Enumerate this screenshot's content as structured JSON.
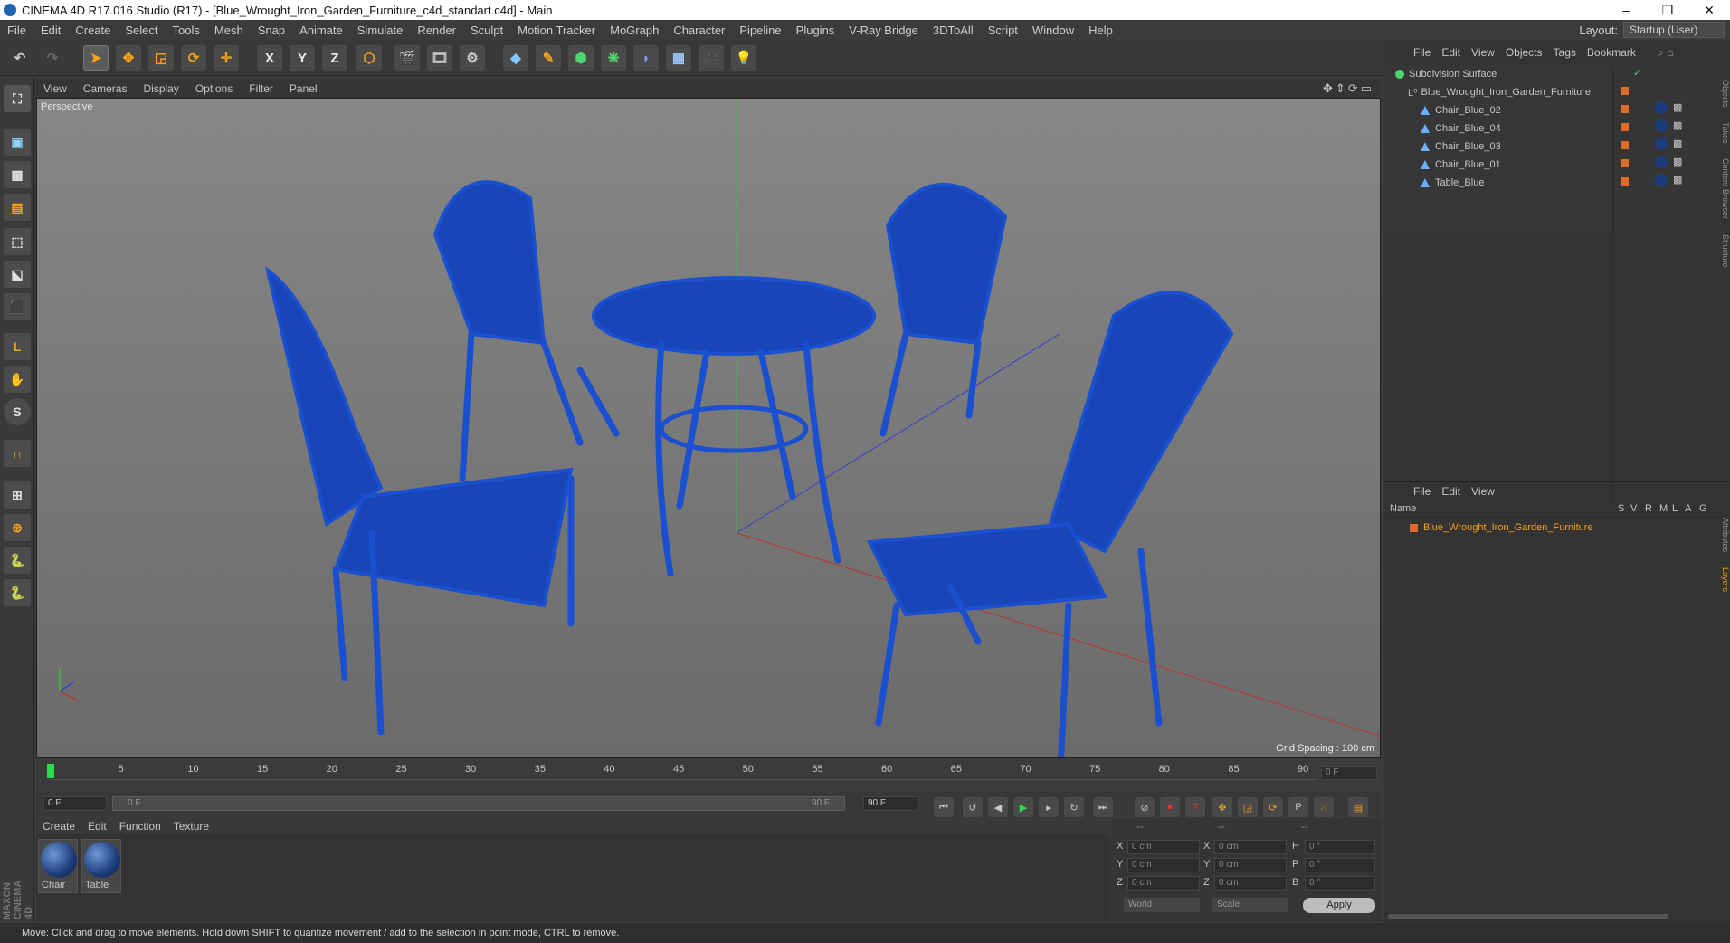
{
  "window": {
    "title": "CINEMA 4D R17.016 Studio (R17) - [Blue_Wrought_Iron_Garden_Furniture_c4d_standart.c4d] - Main",
    "minimize": "–",
    "maximize": "❐",
    "close": "✕"
  },
  "menubar": {
    "items": [
      "File",
      "Edit",
      "Create",
      "Select",
      "Tools",
      "Mesh",
      "Snap",
      "Animate",
      "Simulate",
      "Render",
      "Sculpt",
      "Motion Tracker",
      "MoGraph",
      "Character",
      "Pipeline",
      "Plugins",
      "V-Ray Bridge",
      "3DToAll",
      "Script",
      "Window",
      "Help"
    ],
    "layout_label": "Layout:",
    "layout_value": "Startup (User)"
  },
  "toolbar": {
    "x_label": "X",
    "y_label": "Y",
    "z_label": "Z"
  },
  "viewport": {
    "menu": [
      "View",
      "Cameras",
      "Display",
      "Options",
      "Filter",
      "Panel"
    ],
    "label": "Perspective",
    "grid_spacing": "Grid Spacing : 100 cm",
    "accent_color": "#1a4fd0"
  },
  "timeline": {
    "ticks": [
      "0",
      "5",
      "10",
      "15",
      "20",
      "25",
      "30",
      "35",
      "40",
      "45",
      "50",
      "55",
      "60",
      "65",
      "70",
      "75",
      "80",
      "85",
      "90"
    ],
    "current_frame_field": "0 F",
    "start_field": "0 F",
    "range_start": "0 F",
    "range_end": "90 F",
    "end_field": "90 F"
  },
  "materials": {
    "menu": [
      "Create",
      "Edit",
      "Function",
      "Texture"
    ],
    "items": [
      {
        "label": "Chair"
      },
      {
        "label": "Table"
      }
    ]
  },
  "coordinates": {
    "header": [
      "--",
      "--",
      "--"
    ],
    "rows": [
      {
        "a": "X",
        "av": "0 cm",
        "b": "X",
        "bv": "0 cm",
        "c": "H",
        "cv": "0 °"
      },
      {
        "a": "Y",
        "av": "0 cm",
        "b": "Y",
        "bv": "0 cm",
        "c": "P",
        "cv": "0 °"
      },
      {
        "a": "Z",
        "av": "0 cm",
        "b": "Z",
        "bv": "0 cm",
        "c": "B",
        "cv": "0 °"
      }
    ],
    "space": "World",
    "mode": "Scale",
    "apply": "Apply"
  },
  "object_manager": {
    "menu": [
      "File",
      "Edit",
      "View",
      "Objects",
      "Tags",
      "Bookmark"
    ],
    "objects": [
      {
        "name": "Subdivision Surface",
        "indent": 0
      },
      {
        "name": "Blue_Wrought_Iron_Garden_Furniture",
        "indent": 1
      },
      {
        "name": "Chair_Blue_02",
        "indent": 2
      },
      {
        "name": "Chair_Blue_04",
        "indent": 2
      },
      {
        "name": "Chair_Blue_03",
        "indent": 2
      },
      {
        "name": "Chair_Blue_01",
        "indent": 2
      },
      {
        "name": "Table_Blue",
        "indent": 2
      }
    ],
    "side_tabs": [
      "Objects",
      "Takes",
      "Content Browser",
      "Structure"
    ]
  },
  "layer_manager": {
    "menu": [
      "File",
      "Edit",
      "View"
    ],
    "name_header": "Name",
    "flags": [
      "S",
      "V",
      "R",
      "M",
      "L",
      "A",
      "G"
    ],
    "layer": "Blue_Wrought_Iron_Garden_Furniture",
    "side_tabs": [
      "Attributes",
      "Layers"
    ]
  },
  "brand": "MAXON CINEMA 4D",
  "status": "Move: Click and drag to move elements. Hold down SHIFT to quantize movement / add to the selection in point mode, CTRL to remove."
}
